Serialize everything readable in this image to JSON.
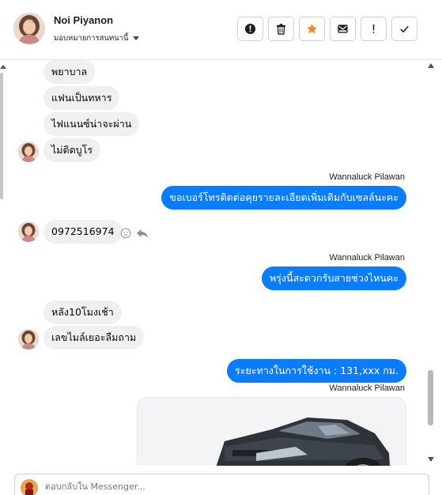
{
  "header": {
    "contact_name": "Noi Piyanon",
    "assign_label": "มอบหมายการสนทนานี้",
    "actions": [
      {
        "name": "spam-button",
        "icon": "alert-circle-icon"
      },
      {
        "name": "delete-button",
        "icon": "trash-icon"
      },
      {
        "name": "star-button",
        "icon": "star-icon",
        "color": "#f0892d"
      },
      {
        "name": "mark-unread-button",
        "icon": "envelope-icon"
      },
      {
        "name": "follow-up-button",
        "icon": "exclamation-icon"
      },
      {
        "name": "done-button",
        "icon": "check-icon"
      }
    ]
  },
  "messages": [
    {
      "side": "in",
      "text": "พยาบาล"
    },
    {
      "side": "in",
      "text": "แฟนเป็นทหาร"
    },
    {
      "side": "in",
      "text": "ไฟแนนซ์น่าจะผ่าน"
    },
    {
      "side": "in",
      "text": "ไม่ติดบูโร"
    },
    {
      "side": "out",
      "sender": "Wannaluck Pilawan",
      "text": "ขอเบอร์โทรติดต่อคุยรายละเอียดเพิ่มเติมกับเซลล์นะคะ"
    },
    {
      "side": "in",
      "text": "0972516974"
    },
    {
      "side": "out",
      "sender": "Wannaluck Pilawan",
      "text": "พรุ่งนี้สะดวกรับสายช่วงไหนคะ"
    },
    {
      "side": "in",
      "text": "หลัง10โมงเช้า"
    },
    {
      "side": "in",
      "text": "เลขไมล์เยอะลืมถาม"
    },
    {
      "side": "out",
      "text": "ระยะทางในการใช้งาน :       131,xxx กม."
    },
    {
      "side": "out",
      "sender": "Wannaluck Pilawan",
      "type": "image",
      "alt": "pickup-truck-photo"
    }
  ],
  "composer": {
    "placeholder": "ตอบกลับใน Messenger..."
  },
  "colors": {
    "outgoing_bubble": "#0a7cff",
    "incoming_bubble": "#f0f0f0",
    "star": "#f0892d"
  }
}
